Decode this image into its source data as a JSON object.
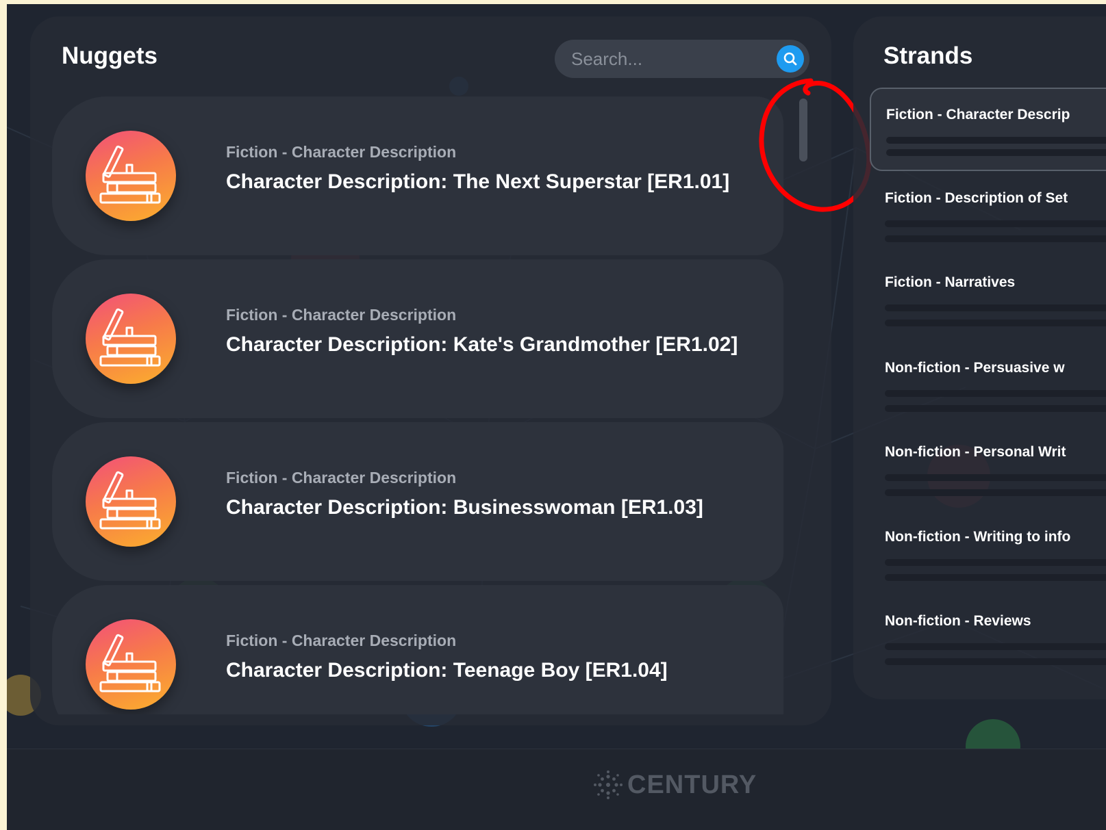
{
  "nuggets": {
    "title": "Nuggets",
    "search": {
      "placeholder": "Search..."
    },
    "items": [
      {
        "strand": "Fiction - Character Description",
        "title": "Character Description: The Next Superstar [ER1.01]",
        "icon": "books-icon"
      },
      {
        "strand": "Fiction - Character Description",
        "title": "Character Description: Kate's Grandmother [ER1.02]",
        "icon": "books-icon"
      },
      {
        "strand": "Fiction - Character Description",
        "title": "Character Description: Businesswoman [ER1.03]",
        "icon": "books-icon"
      },
      {
        "strand": "Fiction - Character Description",
        "title": "Character Description: Teenage Boy [ER1.04]",
        "icon": "books-icon"
      }
    ]
  },
  "strands": {
    "title": "Strands",
    "items": [
      {
        "label": "Fiction - Character Descrip",
        "selected": true
      },
      {
        "label": "Fiction - Description of Set",
        "selected": false
      },
      {
        "label": "Fiction - Narratives",
        "selected": false
      },
      {
        "label": "Non-fiction - Persuasive w",
        "selected": false
      },
      {
        "label": "Non-fiction - Personal Writ",
        "selected": false
      },
      {
        "label": "Non-fiction - Writing to info",
        "selected": false
      },
      {
        "label": "Non-fiction - Reviews",
        "selected": false
      }
    ]
  },
  "footer": {
    "logo_text": "CENTURY"
  },
  "colors": {
    "background": "#1f2530",
    "panel": "#262b35",
    "card": "#2d323c",
    "accent_blue": "#1e9bf0",
    "annotation_red": "#ff0000",
    "icon_gradient": [
      "#f2507a",
      "#f77a4a",
      "#fbb02c"
    ]
  }
}
